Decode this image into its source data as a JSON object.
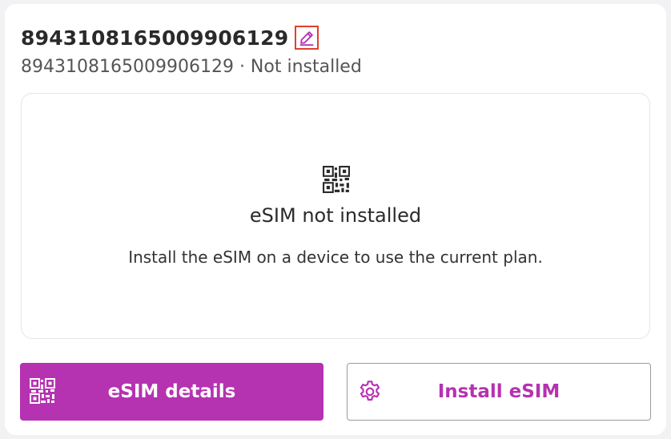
{
  "card": {
    "title": "8943108165009906129",
    "subtitle": "8943108165009906129 · Not installed"
  },
  "status_panel": {
    "heading": "eSIM not installed",
    "description": "Install the eSIM on a device to use the current plan.",
    "icon": "qr-code-icon"
  },
  "actions": {
    "details_label": "eSIM details",
    "install_label": "Install eSIM"
  },
  "colors": {
    "accent": "#b532b1",
    "edit_highlight": "#e0402e"
  },
  "icons": {
    "edit": "pencil-icon",
    "details": "qr-code-icon",
    "install": "gear-icon"
  }
}
